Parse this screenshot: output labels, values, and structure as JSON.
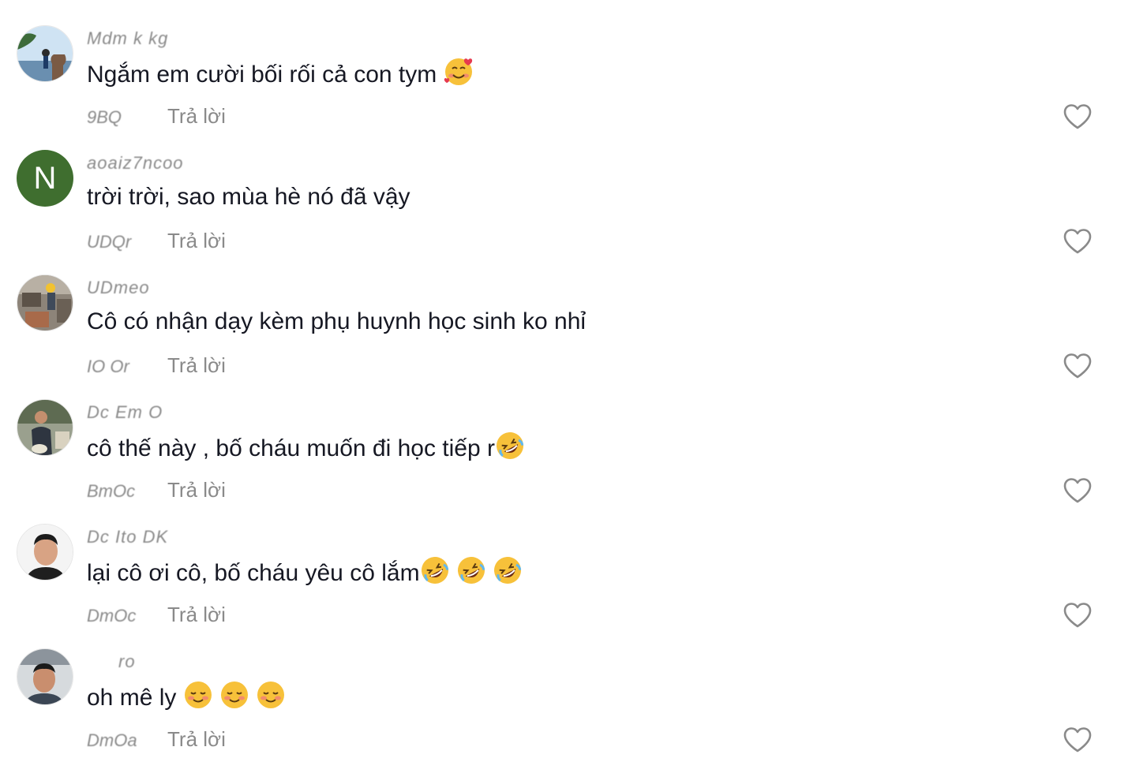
{
  "comments": [
    {
      "username": "Mdm k kg",
      "text": "Ngắm em cười bối rối cả con tym",
      "emojis": [
        "smiling-face-with-hearts"
      ],
      "date": "9BQ",
      "reply_label": "Trả lời",
      "avatar": "landscape-photo"
    },
    {
      "username": "aoaiz7ncoo",
      "text": "trời trời, sao mùa hè nó đã vậy",
      "emojis": [],
      "date": "UDQr",
      "reply_label": "Trả lời",
      "avatar_letter": "N",
      "avatar_color": "#3f6e2f"
    },
    {
      "username": "UDmeo",
      "text": "Cô có nhận dạy kèm phụ huynh học sinh ko nhỉ",
      "emojis": [],
      "date": "IO Or",
      "reply_label": "Trả lời",
      "avatar": "worker-photo"
    },
    {
      "username": "Dc Em O",
      "text": "cô thế này , bố cháu muốn đi học tiếp r",
      "emojis": [
        "rolling-on-floor-laughing"
      ],
      "date": "BmOc",
      "reply_label": "Trả lời",
      "avatar": "man-outdoors-photo"
    },
    {
      "username": "Dc Ito DK",
      "text": "lại cô ơi cô, bố cháu yêu cô lắm",
      "emojis": [
        "rolling-on-floor-laughing",
        "rolling-on-floor-laughing",
        "rolling-on-floor-laughing"
      ],
      "date": "DmOc",
      "reply_label": "Trả lời",
      "avatar": "man-portrait-photo"
    },
    {
      "username": "ro",
      "text": "oh mê ly",
      "emojis": [
        "smiling-face",
        "smiling-face",
        "smiling-face"
      ],
      "date": "DmOa",
      "reply_label": "Trả lời",
      "avatar": "man-selfie-photo"
    }
  ],
  "colors": {
    "text": "#161823",
    "muted": "#8a8a8a",
    "heart_outline": "#8a8a8a",
    "avatar_green": "#3f6e2f",
    "emoji_yellow": "#f7c13a"
  }
}
